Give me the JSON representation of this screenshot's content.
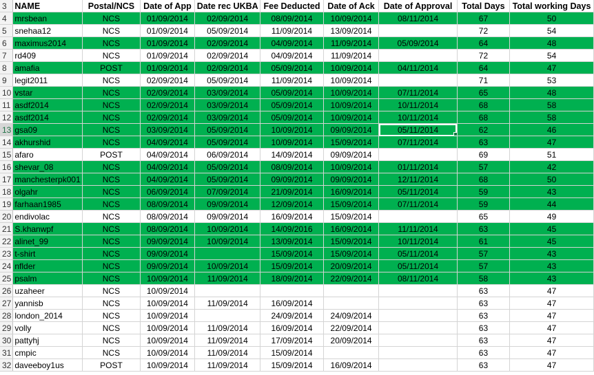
{
  "colors": {
    "highlight": "#00b050",
    "row_header": "#f3f3f3",
    "grid": "#d4d4d4"
  },
  "header": {
    "row_number": "3",
    "columns": [
      "NAME",
      "Postal/NCS",
      "Date of App",
      "Date rec UKBA",
      "Fee Deducted",
      "Date of Ack",
      "Date of Approval",
      "Total Days",
      "Total working Days"
    ]
  },
  "rows": [
    {
      "num": "4",
      "green": true,
      "cells": [
        "mrsbean",
        "NCS",
        "01/09/2014",
        "02/09/2014",
        "08/09/2014",
        "10/09/2014",
        "08/11/2014",
        "67",
        "50"
      ]
    },
    {
      "num": "5",
      "green": false,
      "cells": [
        "snehaa12",
        "NCS",
        "01/09/2014",
        "05/09/2014",
        "11/09/2014",
        "13/09/2014",
        "",
        "72",
        "54"
      ]
    },
    {
      "num": "6",
      "green": true,
      "cells": [
        "maximus2014",
        "NCS",
        "01/09/2014",
        "02/09/2014",
        "04/09/2014",
        "11/09/2014",
        "05/09/2014",
        "64",
        "48"
      ]
    },
    {
      "num": "7",
      "green": false,
      "cells": [
        "rd409",
        "NCS",
        "01/09/2014",
        "02/09/2014",
        "04/09/2014",
        "11/09/2014",
        "",
        "72",
        "54"
      ]
    },
    {
      "num": "8",
      "green": true,
      "cells": [
        "amafia",
        "POST",
        "01/09/2014",
        "02/09/2014",
        "05/09/2014",
        "10/09/2014",
        "04/11/2014",
        "64",
        "47"
      ]
    },
    {
      "num": "9",
      "green": false,
      "cells": [
        "legit2011",
        "NCS",
        "02/09/2014",
        "05/09/2014",
        "11/09/2014",
        "10/09/2014",
        "",
        "71",
        "53"
      ]
    },
    {
      "num": "10",
      "green": true,
      "cells": [
        "vstar",
        "NCS",
        "02/09/2014",
        "03/09/2014",
        "05/09/2014",
        "10/09/2014",
        "07/11/2014",
        "65",
        "48"
      ]
    },
    {
      "num": "11",
      "green": true,
      "cells": [
        "asdf2014",
        "NCS",
        "02/09/2014",
        "03/09/2014",
        "05/09/2014",
        "10/09/2014",
        "10/11/2014",
        "68",
        "58"
      ]
    },
    {
      "num": "12",
      "green": true,
      "cells": [
        "asdf2014",
        "NCS",
        "02/09/2014",
        "03/09/2014",
        "05/09/2014",
        "10/09/2014",
        "10/11/2014",
        "68",
        "58"
      ]
    },
    {
      "num": "13",
      "green": true,
      "cells": [
        "gsa09",
        "NCS",
        "03/09/2014",
        "05/09/2014",
        "10/09/2014",
        "09/09/2014",
        "05/11/2014",
        "62",
        "46"
      ]
    },
    {
      "num": "14",
      "green": true,
      "cells": [
        "akhurshid",
        "NCS",
        "04/09/2014",
        "05/09/2014",
        "10/09/2014",
        "15/09/2014",
        "07/11/2014",
        "63",
        "47"
      ]
    },
    {
      "num": "15",
      "green": false,
      "cells": [
        "afaro",
        "POST",
        "04/09/2014",
        "06/09/2014",
        "14/09/2014",
        "09/09/2014",
        "",
        "69",
        "51"
      ]
    },
    {
      "num": "16",
      "green": true,
      "cells": [
        "shevar_08",
        "NCS",
        "04/09/2014",
        "05/09/2014",
        "08/09/2014",
        "10/09/2014",
        "01/11/2014",
        "57",
        "42"
      ]
    },
    {
      "num": "17",
      "green": true,
      "cells": [
        "manchesterpk001",
        "NCS",
        "04/09/2014",
        "05/09/2014",
        "09/09/2014",
        "09/09/2014",
        "12/11/2014",
        "68",
        "50"
      ]
    },
    {
      "num": "18",
      "green": true,
      "cells": [
        "olgahr",
        "NCS",
        "06/09/2014",
        "07/09/2014",
        "21/09/2014",
        "16/09/2014",
        "05/11/2014",
        "59",
        "43"
      ]
    },
    {
      "num": "19",
      "green": true,
      "cells": [
        "farhaan1985",
        "NCS",
        "08/09/2014",
        "09/09/2014",
        "12/09/2014",
        "15/09/2014",
        "07/11/2014",
        "59",
        "44"
      ]
    },
    {
      "num": "20",
      "green": false,
      "cells": [
        "endivolac",
        "NCS",
        "08/09/2014",
        "09/09/2014",
        "16/09/2014",
        "15/09/2014",
        "",
        "65",
        "49"
      ]
    },
    {
      "num": "21",
      "green": true,
      "cells": [
        "S.khanwpf",
        "NCS",
        "08/09/2014",
        "10/09/2014",
        "14/09/2016",
        "16/09/2014",
        "11/11/2014",
        "63",
        "45"
      ]
    },
    {
      "num": "22",
      "green": true,
      "cells": [
        "alinet_99",
        "NCS",
        "09/09/2014",
        "10/09/2014",
        "13/09/2014",
        "15/09/2014",
        "10/11/2014",
        "61",
        "45"
      ]
    },
    {
      "num": "23",
      "green": true,
      "cells": [
        "t-shirt",
        "NCS",
        "09/09/2014",
        "",
        "15/09/2014",
        "15/09/2014",
        "05/11/2014",
        "57",
        "43"
      ]
    },
    {
      "num": "24",
      "green": true,
      "cells": [
        "nflder",
        "NCS",
        "09/09/2014",
        "10/09/2014",
        "15/09/2014",
        "20/09/2014",
        "05/11/2014",
        "57",
        "43"
      ]
    },
    {
      "num": "25",
      "green": true,
      "cells": [
        "psalm",
        "NCS",
        "10/09/2014",
        "11/09/2014",
        "18/09/2014",
        "22/09/2014",
        "08/11/2014",
        "58",
        "43"
      ]
    },
    {
      "num": "26",
      "green": false,
      "cells": [
        "uzaheer",
        "NCS",
        "10/09/2014",
        "",
        "",
        "",
        "",
        "63",
        "47"
      ]
    },
    {
      "num": "27",
      "green": false,
      "cells": [
        "yannisb",
        "NCS",
        "10/09/2014",
        "11/09/2014",
        "16/09/2014",
        "",
        "",
        "63",
        "47"
      ]
    },
    {
      "num": "28",
      "green": false,
      "cells": [
        "london_2014",
        "NCS",
        "10/09/2014",
        "",
        "24/09/2014",
        "24/09/2014",
        "",
        "63",
        "47"
      ]
    },
    {
      "num": "29",
      "green": false,
      "cells": [
        "volly",
        "NCS",
        "10/09/2014",
        "11/09/2014",
        "16/09/2014",
        "22/09/2014",
        "",
        "63",
        "47"
      ]
    },
    {
      "num": "30",
      "green": false,
      "cells": [
        "pattyhj",
        "NCS",
        "10/09/2014",
        "11/09/2014",
        "17/09/2014",
        "20/09/2014",
        "",
        "63",
        "47"
      ]
    },
    {
      "num": "31",
      "green": false,
      "cells": [
        "cmpic",
        "NCS",
        "10/09/2014",
        "11/09/2014",
        "15/09/2014",
        "",
        "",
        "63",
        "47"
      ]
    },
    {
      "num": "32",
      "green": false,
      "cells": [
        "daveeboy1us",
        "POST",
        "10/09/2014",
        "11/09/2014",
        "15/09/2014",
        "16/09/2014",
        "",
        "63",
        "47"
      ]
    }
  ]
}
